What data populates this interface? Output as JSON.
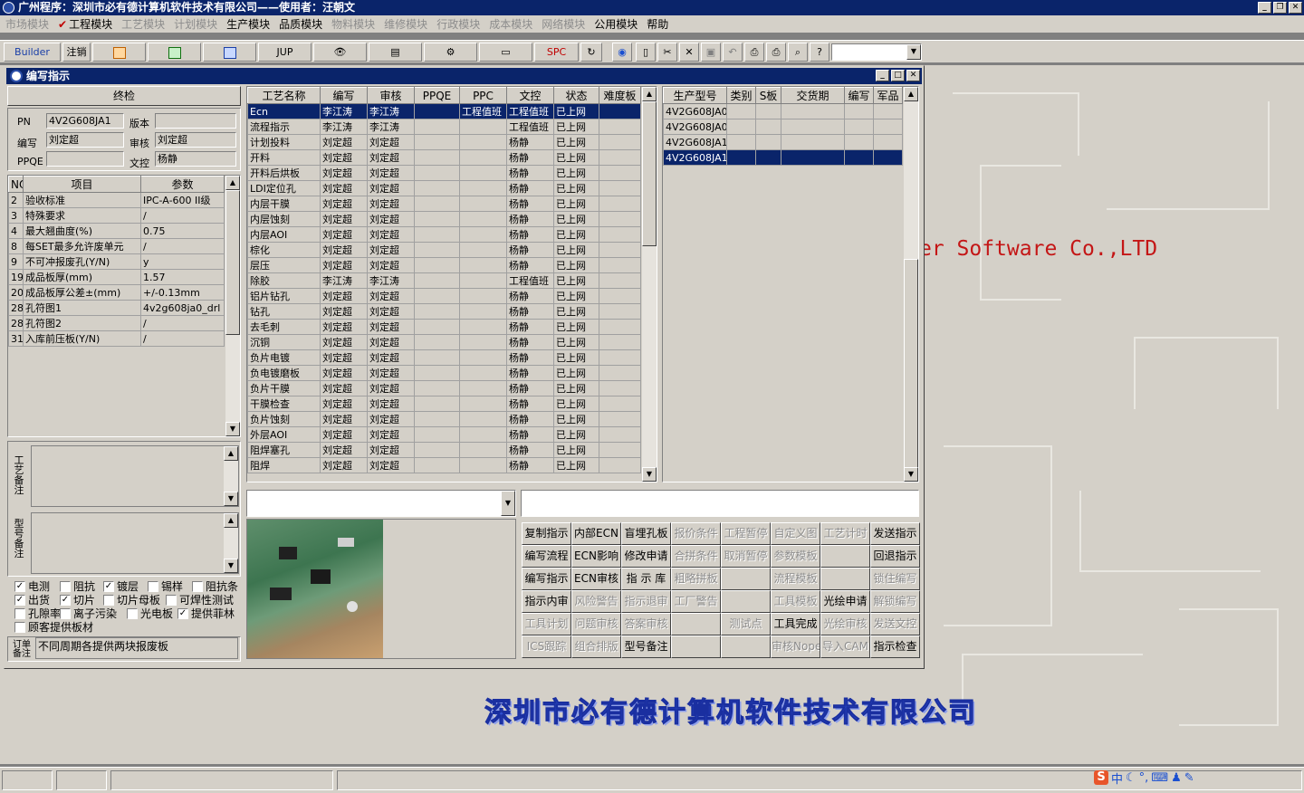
{
  "app": {
    "title": "广州程序：深圳市必有德计算机软件技术有限公司——使用者：汪朝文"
  },
  "menu": [
    {
      "label": "市场模块",
      "enabled": false
    },
    {
      "label": "工程模块",
      "enabled": true,
      "checked": true
    },
    {
      "label": "工艺模块",
      "enabled": false
    },
    {
      "label": "计划模块",
      "enabled": false
    },
    {
      "label": "生产模块",
      "enabled": true
    },
    {
      "label": "品质模块",
      "enabled": true
    },
    {
      "label": "物料模块",
      "enabled": false
    },
    {
      "label": "维修模块",
      "enabled": false
    },
    {
      "label": "行政模块",
      "enabled": false
    },
    {
      "label": "成本模块",
      "enabled": false
    },
    {
      "label": "网络模块",
      "enabled": false
    },
    {
      "label": "公用模块",
      "enabled": true
    },
    {
      "label": "帮助",
      "enabled": true
    }
  ],
  "toolbar": {
    "builder": "Builder",
    "logout": "注销",
    "jup": "JUP",
    "spc": "SPC",
    "icons": [
      "ppt-icon",
      "excel-icon",
      "word-icon",
      "eye-icon",
      "database-icon",
      "network-icon",
      "computer-icon",
      "refresh-icon",
      "globe-icon",
      "new-icon",
      "cut-icon",
      "delete-icon",
      "save-icon",
      "undo-icon",
      "preview-icon",
      "print-icon",
      "find-icon",
      "help-icon"
    ]
  },
  "background": {
    "slogan": "er Software Co.,LTD",
    "company": "深圳市必有德计算机软件技术有限公司"
  },
  "child": {
    "title": "编写指示"
  },
  "header_section": "终检",
  "form": {
    "pn_label": "PN",
    "pn": "4V2G608JA1",
    "version_label": "版本",
    "version": "",
    "writer_label": "编写",
    "writer": "刘定超",
    "reviewer_label": "审核",
    "reviewer": "刘定超",
    "ppqe_label": "PPQE",
    "ppqe": "",
    "doc_label": "文控",
    "doc": "杨静"
  },
  "params": {
    "headers": [
      "NO",
      "项目",
      "参数"
    ],
    "rows": [
      [
        "2",
        "验收标准",
        "IPC-A-600 II级"
      ],
      [
        "3",
        "特殊要求",
        "/"
      ],
      [
        "4",
        "最大翘曲度(%)",
        "0.75"
      ],
      [
        "8",
        "每SET最多允许废单元",
        "/"
      ],
      [
        "9",
        "不可冲报废孔(Y/N)",
        "y"
      ],
      [
        "19",
        "成品板厚(mm)",
        "1.57"
      ],
      [
        "20",
        "成品板厚公差±(mm)",
        "+/-0.13mm"
      ],
      [
        "28",
        "孔符图1",
        "4v2g608ja0_drl"
      ],
      [
        "28",
        "孔符图2",
        "/"
      ],
      [
        "31",
        "入库前压板(Y/N)",
        "/"
      ]
    ]
  },
  "notes": {
    "process_label": "工艺备注",
    "model_label": "型号备注",
    "order_label": "订单备注",
    "order_note": "不同周期各提供两块报废板"
  },
  "checkboxes": [
    {
      "label": "电测",
      "checked": true
    },
    {
      "label": "阻抗",
      "checked": false
    },
    {
      "label": "镀层",
      "checked": true
    },
    {
      "label": "锡样",
      "checked": false
    },
    {
      "label": "阻抗条",
      "checked": false
    },
    {
      "label": "出货",
      "checked": true
    },
    {
      "label": "切片",
      "checked": true
    },
    {
      "label": "切片母板",
      "checked": false
    },
    {
      "label": "可焊性测试",
      "checked": false
    },
    {
      "label": "孔隙率",
      "checked": false
    },
    {
      "label": "离子污染",
      "checked": false
    },
    {
      "label": "光电板",
      "checked": false
    },
    {
      "label": "提供菲林",
      "checked": true
    },
    {
      "label": "顾客提供板材",
      "checked": false
    }
  ],
  "process": {
    "headers": [
      "工艺名称",
      "编写",
      "审核",
      "PPQE",
      "PPC",
      "文控",
      "状态",
      "难度板"
    ],
    "rows": [
      [
        "Ecn",
        "李江涛",
        "李江涛",
        "",
        "工程值班",
        "工程值班",
        "已上网",
        ""
      ],
      [
        "流程指示",
        "李江涛",
        "李江涛",
        "",
        "",
        "工程值班",
        "已上网",
        ""
      ],
      [
        "计划投料",
        "刘定超",
        "刘定超",
        "",
        "",
        "杨静",
        "已上网",
        ""
      ],
      [
        "开料",
        "刘定超",
        "刘定超",
        "",
        "",
        "杨静",
        "已上网",
        ""
      ],
      [
        "开料后烘板",
        "刘定超",
        "刘定超",
        "",
        "",
        "杨静",
        "已上网",
        ""
      ],
      [
        "LDI定位孔",
        "刘定超",
        "刘定超",
        "",
        "",
        "杨静",
        "已上网",
        ""
      ],
      [
        "内层干膜",
        "刘定超",
        "刘定超",
        "",
        "",
        "杨静",
        "已上网",
        ""
      ],
      [
        "内层蚀刻",
        "刘定超",
        "刘定超",
        "",
        "",
        "杨静",
        "已上网",
        ""
      ],
      [
        "内层AOI",
        "刘定超",
        "刘定超",
        "",
        "",
        "杨静",
        "已上网",
        ""
      ],
      [
        "棕化",
        "刘定超",
        "刘定超",
        "",
        "",
        "杨静",
        "已上网",
        ""
      ],
      [
        "层压",
        "刘定超",
        "刘定超",
        "",
        "",
        "杨静",
        "已上网",
        ""
      ],
      [
        "除胶",
        "李江涛",
        "李江涛",
        "",
        "",
        "工程值班",
        "已上网",
        ""
      ],
      [
        "铝片钻孔",
        "刘定超",
        "刘定超",
        "",
        "",
        "杨静",
        "已上网",
        ""
      ],
      [
        "钻孔",
        "刘定超",
        "刘定超",
        "",
        "",
        "杨静",
        "已上网",
        ""
      ],
      [
        "去毛刺",
        "刘定超",
        "刘定超",
        "",
        "",
        "杨静",
        "已上网",
        ""
      ],
      [
        "沉铜",
        "刘定超",
        "刘定超",
        "",
        "",
        "杨静",
        "已上网",
        ""
      ],
      [
        "负片电镀",
        "刘定超",
        "刘定超",
        "",
        "",
        "杨静",
        "已上网",
        ""
      ],
      [
        "负电镀磨板",
        "刘定超",
        "刘定超",
        "",
        "",
        "杨静",
        "已上网",
        ""
      ],
      [
        "负片干膜",
        "刘定超",
        "刘定超",
        "",
        "",
        "杨静",
        "已上网",
        ""
      ],
      [
        "干膜检查",
        "刘定超",
        "刘定超",
        "",
        "",
        "杨静",
        "已上网",
        ""
      ],
      [
        "负片蚀刻",
        "刘定超",
        "刘定超",
        "",
        "",
        "杨静",
        "已上网",
        ""
      ],
      [
        "外层AOI",
        "刘定超",
        "刘定超",
        "",
        "",
        "杨静",
        "已上网",
        ""
      ],
      [
        "阻焊塞孔",
        "刘定超",
        "刘定超",
        "",
        "",
        "杨静",
        "已上网",
        ""
      ],
      [
        "阻焊",
        "刘定超",
        "刘定超",
        "",
        "",
        "杨静",
        "已上网",
        ""
      ]
    ]
  },
  "models": {
    "headers": [
      "生产型号",
      "类别",
      "S板",
      "交货期",
      "编写",
      "军品"
    ],
    "rows": [
      [
        "4V2G608JA0",
        "",
        "",
        "",
        "",
        ""
      ],
      [
        "4V2G608JA0",
        "",
        "",
        "",
        "",
        ""
      ],
      [
        "4V2G608JA1",
        "",
        "",
        "",
        "",
        ""
      ],
      [
        "4V2G608JA1",
        "",
        "",
        "",
        "",
        ""
      ]
    ]
  },
  "buttons": [
    [
      {
        "label": "复制指示",
        "enabled": true
      },
      {
        "label": "内部ECN",
        "enabled": true
      },
      {
        "label": "盲埋孔板",
        "enabled": true
      },
      {
        "label": "报价条件",
        "enabled": false
      },
      {
        "label": "工程暂停",
        "enabled": false
      },
      {
        "label": "自定义图",
        "enabled": false
      },
      {
        "label": "工艺计时",
        "enabled": false
      },
      {
        "label": "发送指示",
        "enabled": true
      }
    ],
    [
      {
        "label": "编写流程",
        "enabled": true
      },
      {
        "label": "ECN影响",
        "enabled": true
      },
      {
        "label": "修改申请",
        "enabled": true
      },
      {
        "label": "合拼条件",
        "enabled": false
      },
      {
        "label": "取消暂停",
        "enabled": false
      },
      {
        "label": "参数模板",
        "enabled": false
      },
      {
        "label": "",
        "enabled": false
      },
      {
        "label": "回退指示",
        "enabled": true
      }
    ],
    [
      {
        "label": "编写指示",
        "enabled": true
      },
      {
        "label": "ECN审核",
        "enabled": true
      },
      {
        "label": "指 示 库",
        "enabled": true
      },
      {
        "label": "粗略拼板",
        "enabled": false
      },
      {
        "label": "",
        "enabled": false
      },
      {
        "label": "流程模板",
        "enabled": false
      },
      {
        "label": "",
        "enabled": false
      },
      {
        "label": "锁住编写",
        "enabled": false
      }
    ],
    [
      {
        "label": "指示内审",
        "enabled": true
      },
      {
        "label": "风险警告",
        "enabled": false
      },
      {
        "label": "指示退审",
        "enabled": false
      },
      {
        "label": "工厂警告",
        "enabled": false
      },
      {
        "label": "",
        "enabled": false
      },
      {
        "label": "工具模板",
        "enabled": false
      },
      {
        "label": "光绘申请",
        "enabled": true
      },
      {
        "label": "解锁编写",
        "enabled": false
      }
    ],
    [
      {
        "label": "工具计划",
        "enabled": false
      },
      {
        "label": "问题审核",
        "enabled": false
      },
      {
        "label": "答案审核",
        "enabled": false
      },
      {
        "label": "",
        "enabled": false
      },
      {
        "label": "测试点",
        "enabled": false
      },
      {
        "label": "工具完成",
        "enabled": true
      },
      {
        "label": "光绘审核",
        "enabled": false
      },
      {
        "label": "发送文控",
        "enabled": false
      }
    ],
    [
      {
        "label": "ICS跟踪",
        "enabled": false
      },
      {
        "label": "组合排版",
        "enabled": false
      },
      {
        "label": "型号备注",
        "enabled": true
      },
      {
        "label": "",
        "enabled": false
      },
      {
        "label": "",
        "enabled": false
      },
      {
        "label": "审核Nope",
        "enabled": false
      },
      {
        "label": "导入CAM",
        "enabled": false
      },
      {
        "label": "指示检查",
        "enabled": true
      }
    ]
  ],
  "status": {
    "ime": "中"
  },
  "colors": {
    "titlebar": "#0a246a",
    "face": "#d4d0c8",
    "selection": "#0a246a",
    "slogan": "#c41616",
    "company": "#2f4fcf"
  }
}
